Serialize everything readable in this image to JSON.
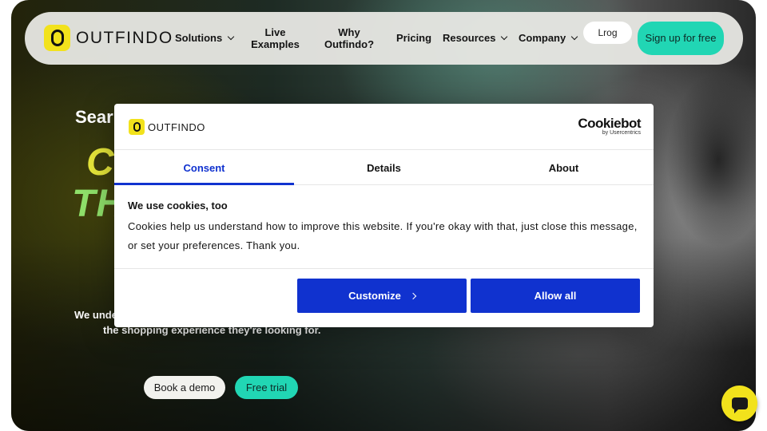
{
  "nav": {
    "logo_text": "OUTFINDO",
    "items": [
      {
        "label": "Solutions",
        "has_dropdown": true
      },
      {
        "label": "Live Examples",
        "has_dropdown": false
      },
      {
        "label": "Why Outfindo?",
        "has_dropdown": false
      },
      {
        "label": "Pricing",
        "has_dropdown": false
      },
      {
        "label": "Resources",
        "has_dropdown": true
      },
      {
        "label": "Company",
        "has_dropdown": true
      }
    ],
    "login_label": "Lrog",
    "signup_label": "Sign up for free"
  },
  "hero": {
    "heading_partial": "Sear",
    "big_line1_partial": "CI",
    "big_line2_partial": "THI",
    "subtext_line1_partial": "We unde",
    "subtext_line2": "the shopping experience they're looking for.",
    "book_demo_label": "Book a demo",
    "free_trial_label": "Free trial"
  },
  "cookie": {
    "logo_text": "OUTFINDO",
    "brand_main": "Cookiebot",
    "brand_sub": "by Usercentrics",
    "tabs": [
      {
        "label": "Consent",
        "active": true
      },
      {
        "label": "Details",
        "active": false
      },
      {
        "label": "About",
        "active": false
      }
    ],
    "title": "We use cookies, too",
    "body": "Cookies help us understand how to improve this website. If you're okay with that, just close this message, or set your preferences. Thank you.",
    "customize_label": "Customize",
    "allow_all_label": "Allow all"
  },
  "chat": {
    "icon": "chat-bubble-icon"
  },
  "colors": {
    "accent_teal": "#21d6b4",
    "brand_yellow": "#f2e21c",
    "cookie_blue": "#1032cf"
  }
}
